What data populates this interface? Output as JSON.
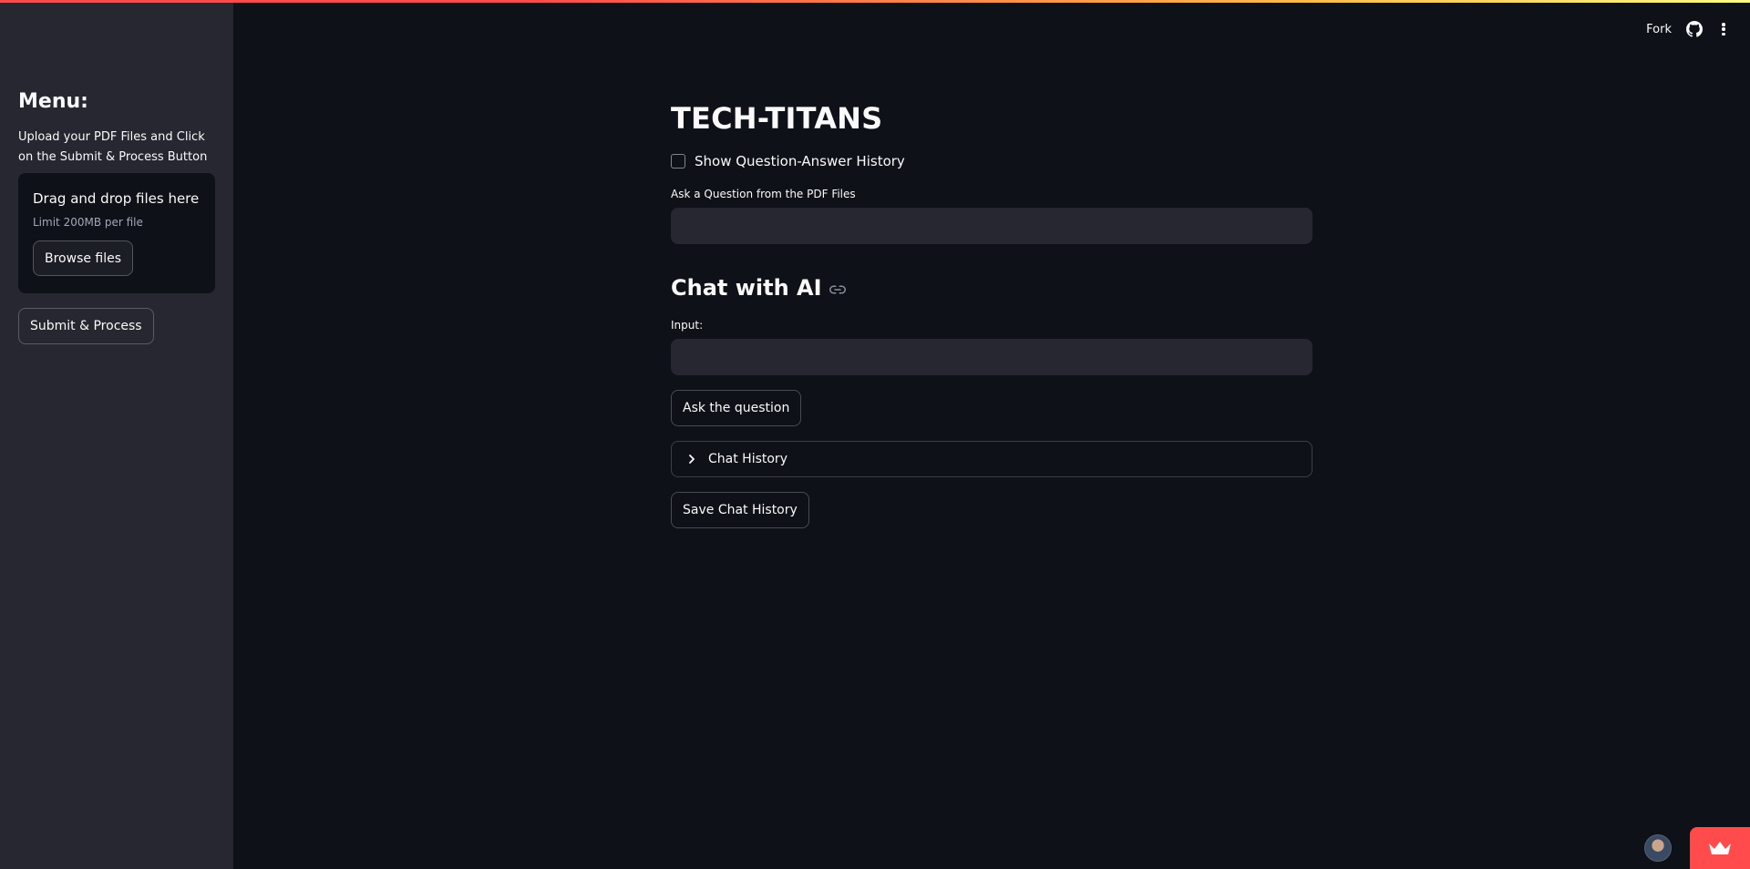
{
  "header": {
    "fork_label": "Fork",
    "github_icon": "github-icon",
    "menu_icon": "kebab-menu-icon"
  },
  "sidebar": {
    "title": "Menu:",
    "instructions": "Upload your PDF Files and Click on the Submit & Process Button",
    "uploader": {
      "title": "Drag and drop files here",
      "limit": "Limit 200MB per file",
      "browse_label": "Browse files"
    },
    "submit_label": "Submit & Process"
  },
  "main": {
    "title": "TECH-TITANS",
    "show_history_label": "Show Question-Answer History",
    "show_history_checked": false,
    "pdf_question": {
      "label": "Ask a Question from the PDF Files",
      "value": ""
    },
    "chat_heading": "Chat with AI",
    "input": {
      "label": "Input:",
      "value": ""
    },
    "ask_label": "Ask the question",
    "chat_history_label": "Chat History",
    "save_label": "Save Chat History"
  },
  "colors": {
    "background": "#0e1117",
    "sidebar": "#262730",
    "input_bg": "#262730",
    "accent": "#ff4b4b"
  }
}
